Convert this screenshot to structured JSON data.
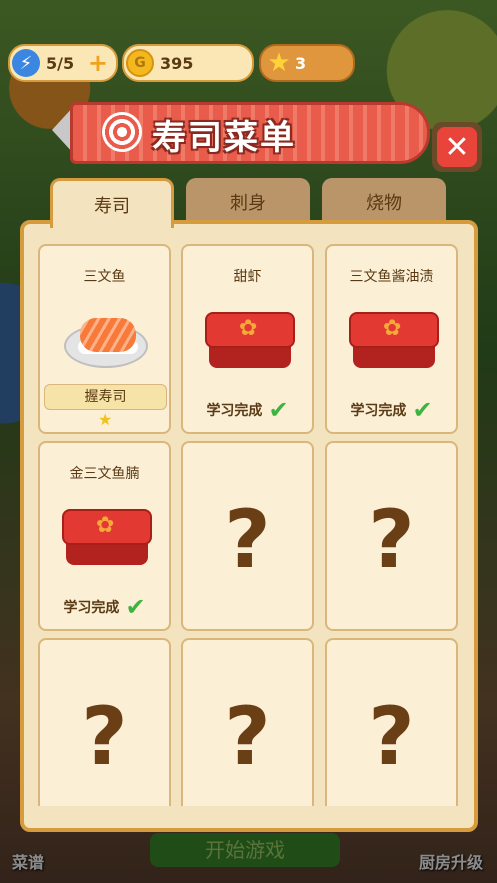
{
  "hud": {
    "energy": "5/5",
    "coins": "395",
    "stars": "3"
  },
  "banner": {
    "title": "寿司菜单"
  },
  "tabs": [
    {
      "label": "寿司"
    },
    {
      "label": "刺身"
    },
    {
      "label": "烧物"
    }
  ],
  "cards": [
    {
      "name": "三文鱼",
      "badge": "握寿司",
      "state": "unlocked"
    },
    {
      "name": "甜虾",
      "status": "学习完成",
      "state": "learned"
    },
    {
      "name": "三文鱼酱油渍",
      "status": "学习完成",
      "state": "learned"
    },
    {
      "name": "金三文鱼腩",
      "status": "学习完成",
      "state": "learned"
    },
    {
      "mystery": "?",
      "state": "locked"
    },
    {
      "mystery": "?",
      "state": "locked"
    },
    {
      "mystery": "?",
      "state": "locked"
    },
    {
      "mystery": "?",
      "state": "locked"
    },
    {
      "mystery": "?",
      "state": "locked"
    }
  ],
  "bottom": {
    "left": "菜谱",
    "center": "开始游戏",
    "right": "厨房升级"
  }
}
